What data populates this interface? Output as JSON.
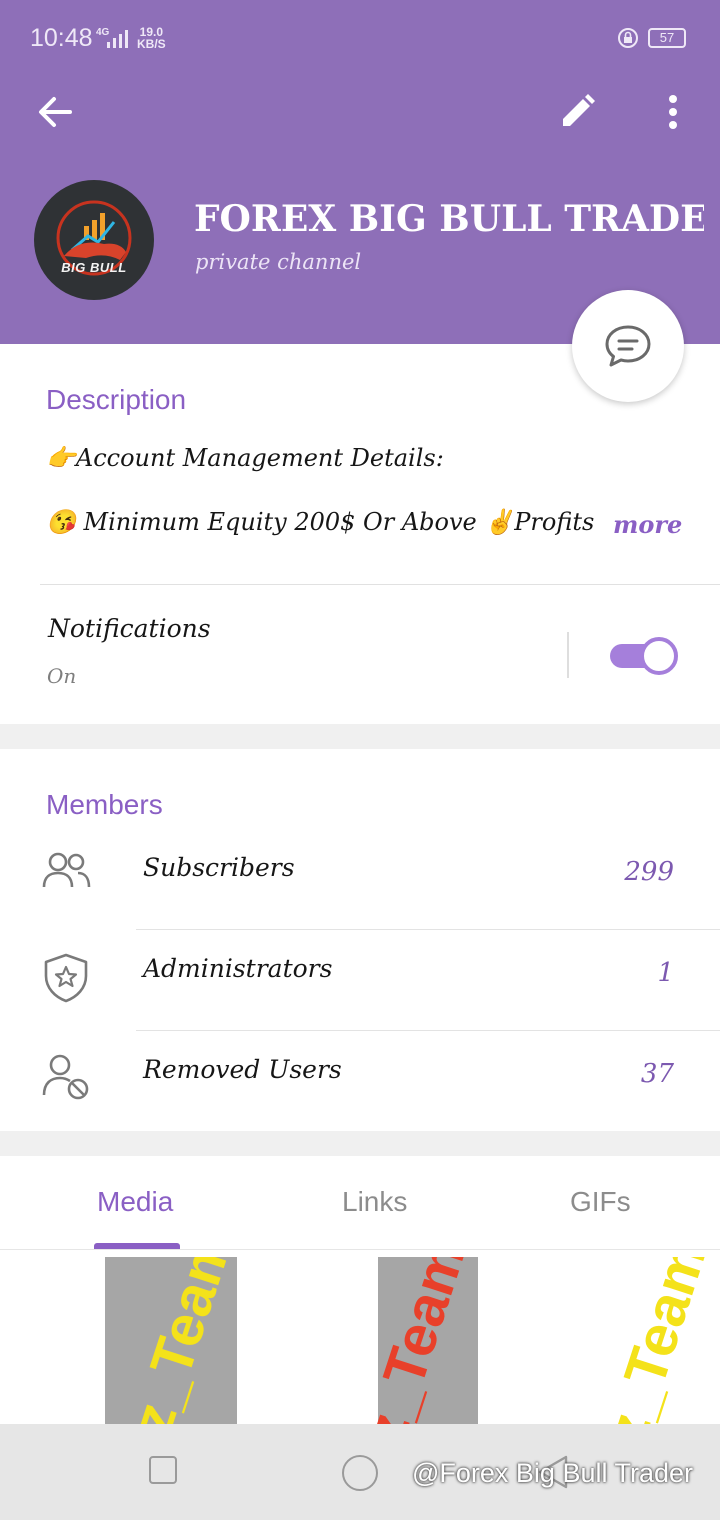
{
  "status_bar": {
    "time": "10:48",
    "network": "4G",
    "speed_value": "19.0",
    "speed_unit": "KB/S",
    "battery": "57"
  },
  "header": {
    "channel_name": "FOREX BIG BULL TRADER",
    "channel_type": "private channel",
    "avatar_text": "BIG BULL",
    "background_color": "#8e6fb8"
  },
  "description": {
    "title": "Description",
    "line1": "👉Account Management Details:",
    "line2": "😘 Minimum Equity 200$ Or Above ✌️Profits",
    "more_label": "more"
  },
  "notifications": {
    "label": "Notifications",
    "status": "On",
    "enabled": true
  },
  "members": {
    "title": "Members",
    "rows": [
      {
        "label": "Subscribers",
        "value": "299",
        "icon": "users-icon"
      },
      {
        "label": "Administrators",
        "value": "1",
        "icon": "shield-star-icon"
      },
      {
        "label": "Removed Users",
        "value": "37",
        "icon": "user-blocked-icon"
      }
    ]
  },
  "media_tabs": {
    "tabs": [
      "Media",
      "Links",
      "GIFs"
    ],
    "active": "Media"
  },
  "media_thumbs": {
    "watermark": "z_Team"
  },
  "nav_watermark": "@Forex Big Bull Trader",
  "accent_color": "#8a5fc4"
}
